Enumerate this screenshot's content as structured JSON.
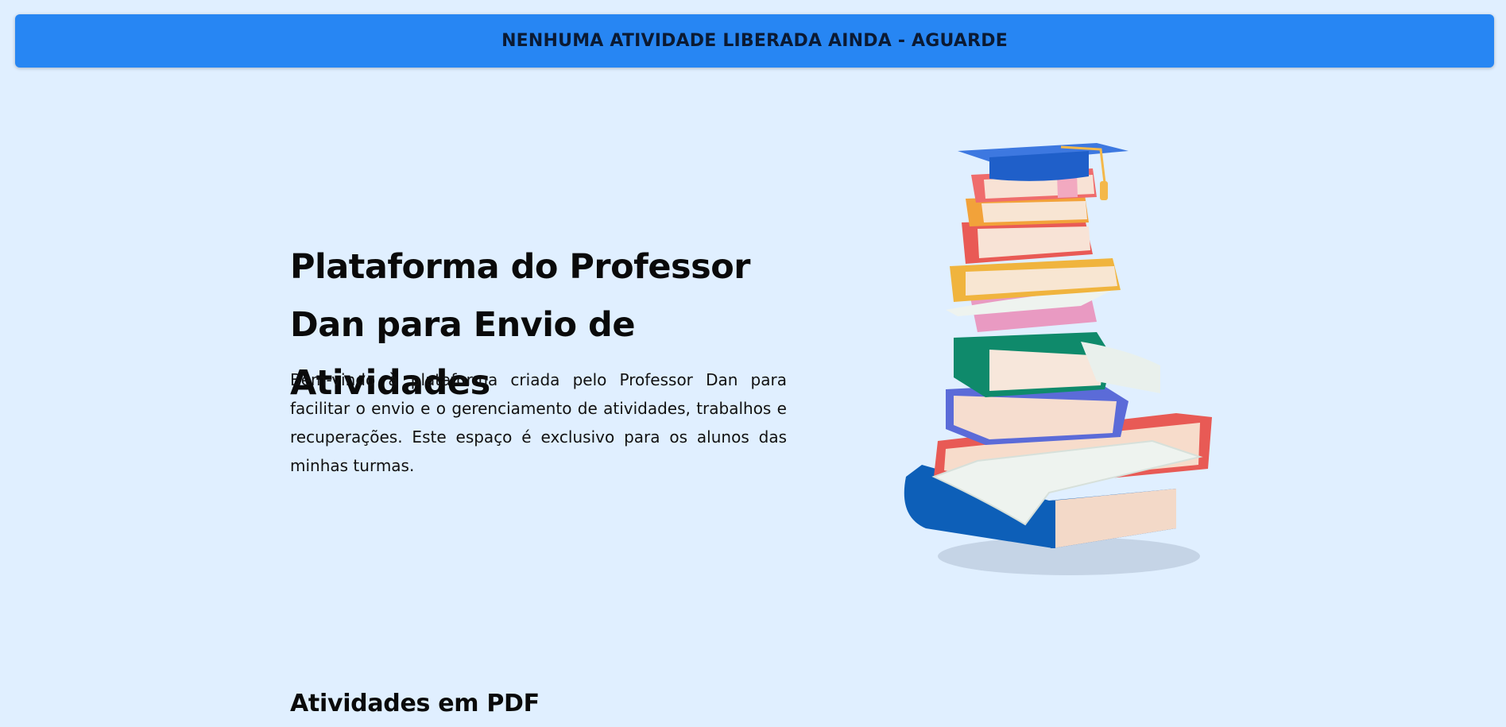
{
  "banner": {
    "text": "NENHUMA ATIVIDADE LIBERADA AINDA - AGUARDE"
  },
  "hero": {
    "title": "Plataforma do Professor Dan para Envio de Atividades",
    "description": "Bem-vindo à plataforma criada pelo Professor Dan para facilitar o envio e o gerenciamento de atividades, trabalhos e recuperações. Este espaço é exclusivo para os alunos das minhas turmas.",
    "image_icon": "stack-of-books-with-graduation-cap-illustration"
  },
  "sections": {
    "pdf_title": "Atividades em PDF"
  },
  "colors": {
    "background": "#e0efff",
    "banner": "#2786f3",
    "text": "#0a0a0a"
  }
}
